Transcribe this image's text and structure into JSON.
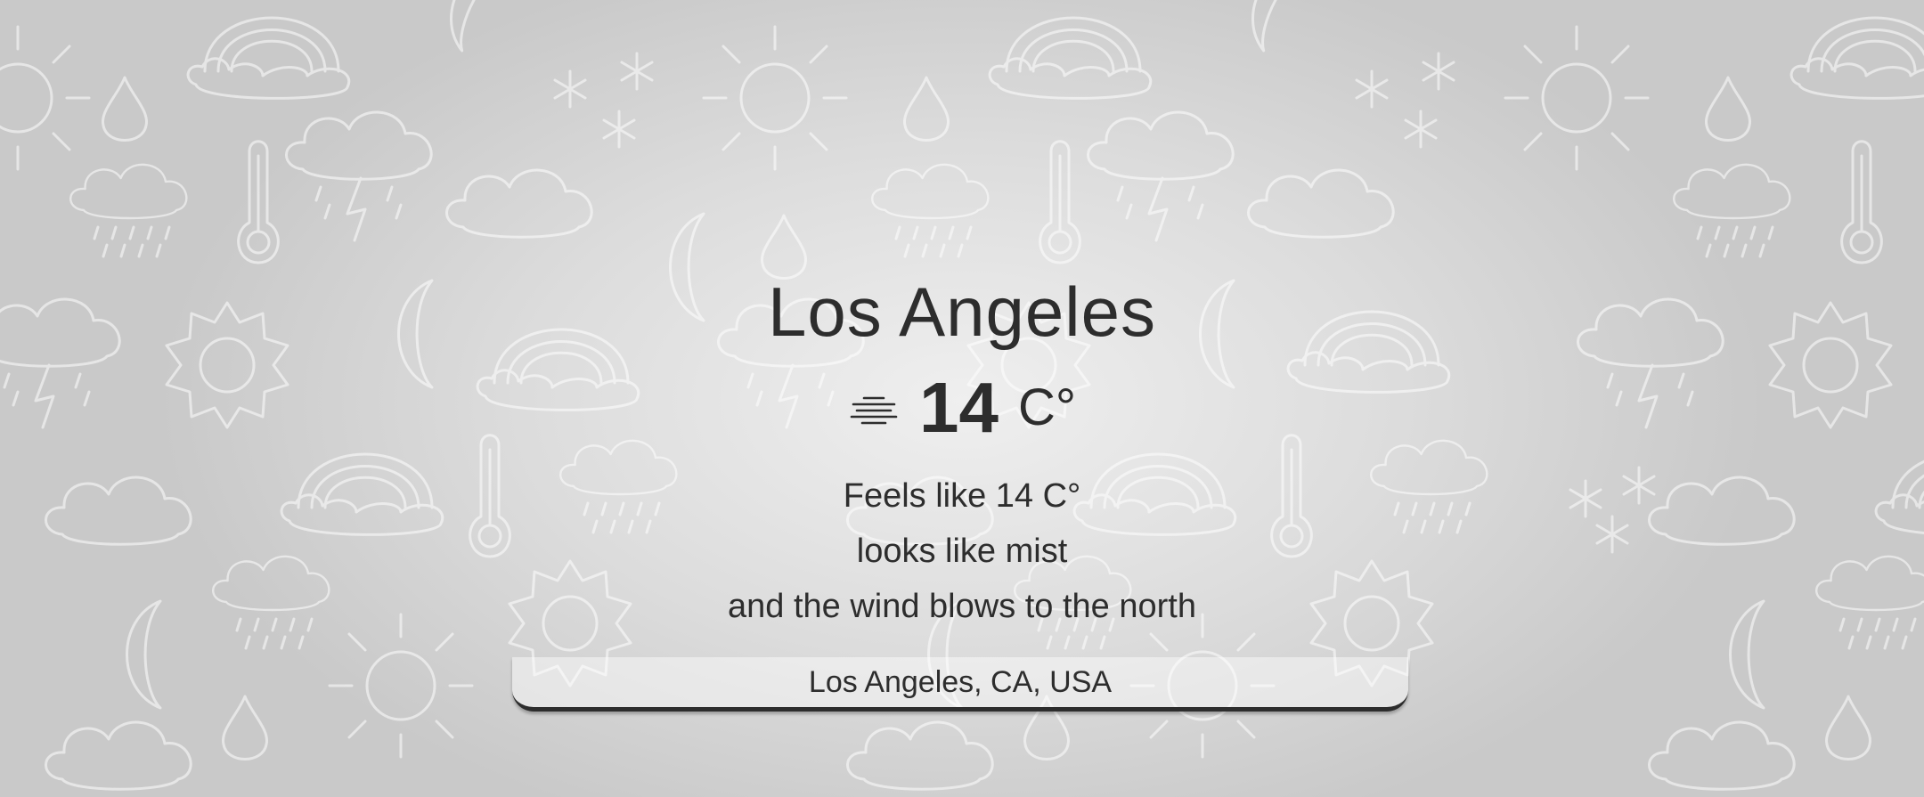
{
  "weather": {
    "city": "Los Angeles",
    "temperature": "14",
    "unit": "C°",
    "condition_icon": "mist-icon",
    "feels_like": "Feels like 14 C°",
    "looks_like": "looks like mist",
    "wind": "and the wind blows to the north"
  },
  "search": {
    "value": "Los Angeles, CA, USA"
  },
  "colors": {
    "text": "#2d2d2d",
    "background": "#d6d6d6",
    "doodle": "#ffffff"
  }
}
